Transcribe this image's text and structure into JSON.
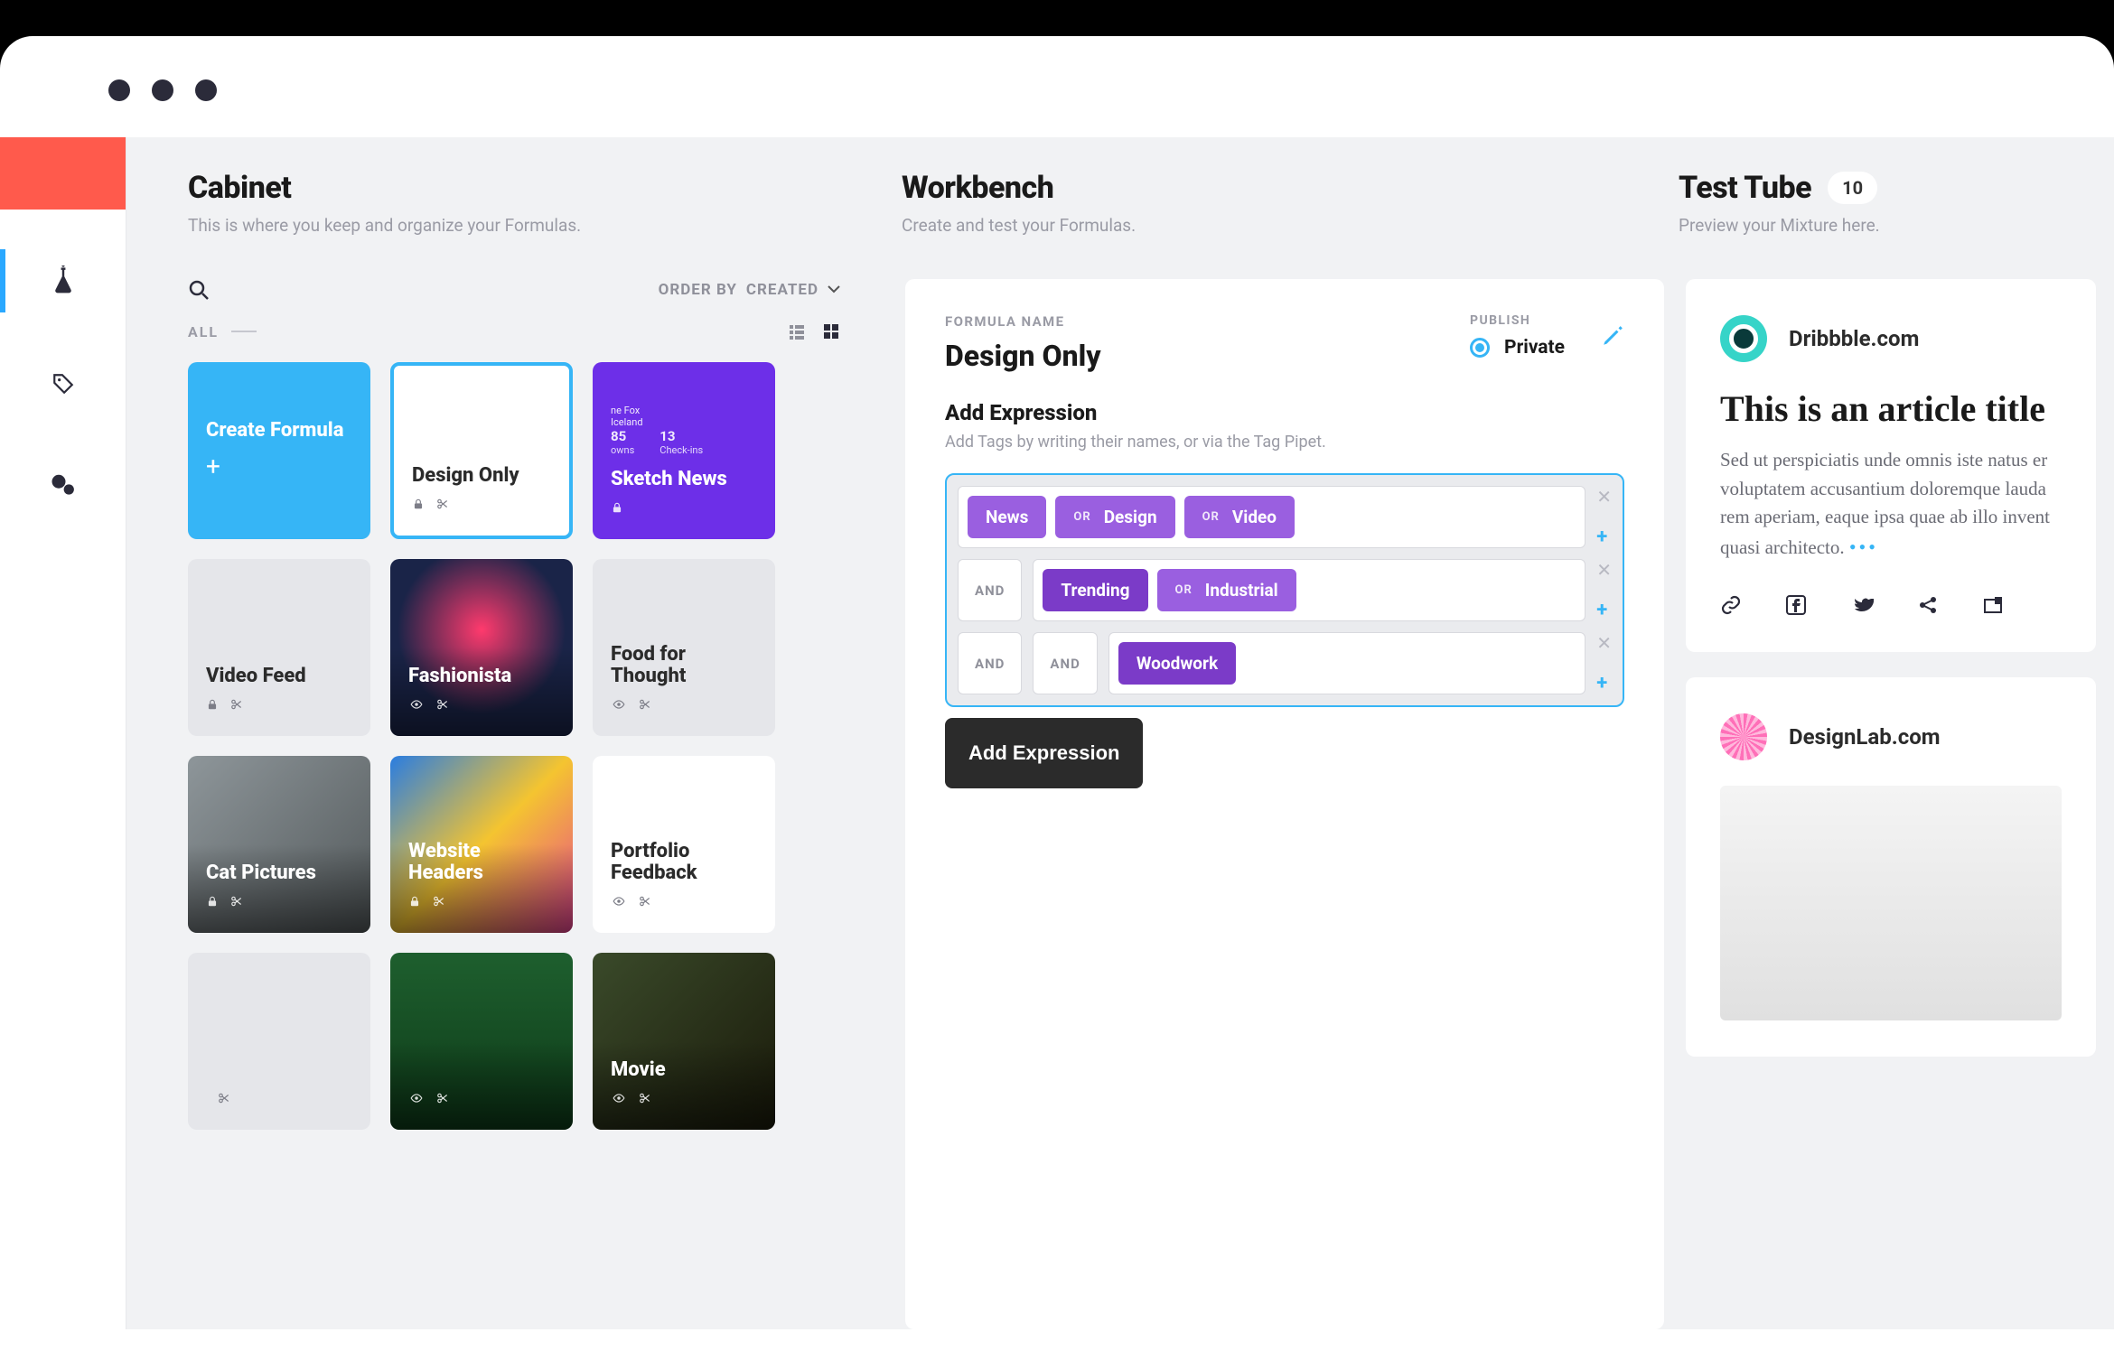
{
  "headers": {
    "cabinet": {
      "title": "Cabinet",
      "subtitle": "This is where you keep and organize your Formulas."
    },
    "workbench": {
      "title": "Workbench",
      "subtitle": "Create and test your Formulas."
    },
    "testtube": {
      "title": "Test Tube",
      "subtitle": "Preview your Mixture here.",
      "count": "10"
    }
  },
  "cabinet": {
    "order_by_label": "ORDER BY",
    "order_by_value": "CREATED",
    "filter_label": "ALL",
    "cards": [
      {
        "type": "create",
        "title": "Create Formula"
      },
      {
        "type": "selected",
        "title": "Design Only",
        "locked": true
      },
      {
        "type": "purple",
        "title": "Sketch News",
        "user": "ne Fox",
        "loc": "Iceland",
        "stat1": "85",
        "stat1_label": "owns",
        "stat2": "13",
        "stat2_label": "Check-ins"
      },
      {
        "type": "plain",
        "title": "Video Feed",
        "locked": true
      },
      {
        "type": "img",
        "bg": "bg-fashion",
        "title": "Fashionista",
        "visible": true
      },
      {
        "type": "plain",
        "title": "Food for Thought",
        "visible": true
      },
      {
        "type": "img",
        "bg": "bg-cat",
        "title": "Cat Pictures",
        "locked": true
      },
      {
        "type": "img",
        "bg": "bg-headers",
        "title": "Website Headers",
        "locked": true
      },
      {
        "type": "img",
        "bg": "bg-portfolio",
        "title": "Portfolio Feedback",
        "whitebg": true
      },
      {
        "type": "plain",
        "title": ""
      },
      {
        "type": "img",
        "bg": "bg-green",
        "title": ""
      },
      {
        "type": "img",
        "bg": "bg-movie",
        "title": "Movie"
      }
    ]
  },
  "workbench": {
    "formula_name_label": "FORMULA NAME",
    "formula_name": "Design Only",
    "publish_label": "PUBLISH",
    "publish_value": "Private",
    "add_expression_title": "Add Expression",
    "add_expression_sub": "Add Tags by writing their names, or via the Tag Pipet.",
    "and_label": "AND",
    "or_label": "OR",
    "rows": [
      {
        "tags": [
          "News",
          "Design",
          "Video"
        ]
      },
      {
        "tags": [
          "Trending",
          "Industrial"
        ]
      },
      {
        "tags": [
          "Woodwork"
        ]
      }
    ],
    "add_button": "Add Expression"
  },
  "testtube": {
    "articles": [
      {
        "source": "Dribbble.com",
        "avatar": "teal",
        "title": "This is an article title",
        "body": "Sed ut perspiciatis unde omnis iste natus er voluptatem accusantium doloremque lauda rem aperiam, eaque ipsa quae ab illo invent quasi architecto."
      },
      {
        "source": "DesignLab.com",
        "avatar": "pink"
      }
    ]
  }
}
